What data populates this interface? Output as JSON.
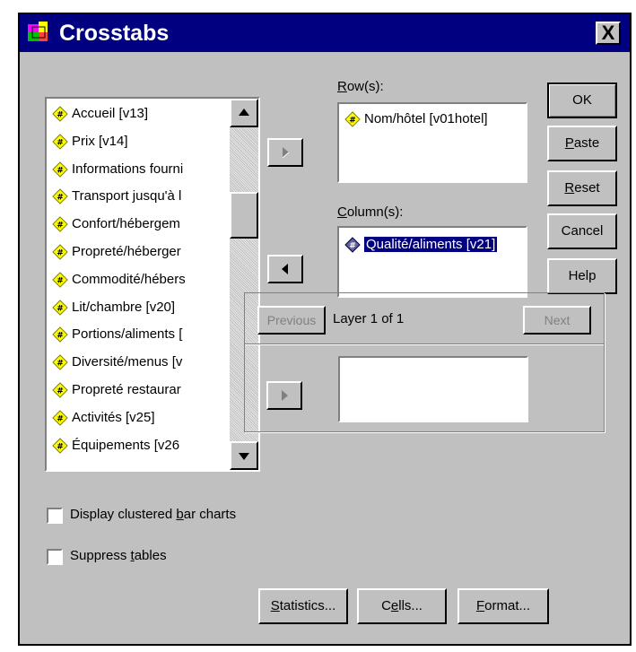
{
  "window": {
    "title": "Crosstabs",
    "close_label": "X"
  },
  "source_variables": [
    "Accueil [v13]",
    "Prix [v14]",
    "Informations fourni",
    "Transport jusqu'à l",
    "Confort/hébergem",
    "Propreté/héberger",
    "Commodité/hébers",
    "Lit/chambre [v20]",
    "Portions/aliments [",
    "Diversité/menus [v",
    "Propreté restaurar",
    "Activités [v25]",
    "Équipements [v26"
  ],
  "rows": {
    "label_u": "R",
    "label_rest": "ow(s):",
    "items": [
      "Nom/hôtel [v01hotel]"
    ]
  },
  "columns": {
    "label_u": "C",
    "label_rest": "olumn(s):",
    "items": [
      "Qualité/aliments [v21]"
    ]
  },
  "buttons": {
    "ok": "OK",
    "paste_u": "P",
    "paste_rest": "aste",
    "reset_u": "R",
    "reset_rest": "eset",
    "cancel": "Cancel",
    "help": "Help"
  },
  "layer": {
    "previous": "Previous",
    "status": "Layer 1 of 1",
    "next": "Next"
  },
  "options": {
    "clustered_pre": "Display clustered ",
    "clustered_u": "b",
    "clustered_post": "ar charts",
    "clustered_checked": false,
    "suppress_pre": "Suppress ",
    "suppress_u": "t",
    "suppress_post": "ables",
    "suppress_checked": false
  },
  "bottom_buttons": {
    "statistics_u": "S",
    "statistics_rest": "tatistics...",
    "cells_pre": "C",
    "cells_u": "e",
    "cells_post": "lls...",
    "format_u": "F",
    "format_rest": "ormat..."
  },
  "colors": {
    "titlebar": "#000080",
    "selection": "#000080",
    "face": "#c0c0c0"
  }
}
